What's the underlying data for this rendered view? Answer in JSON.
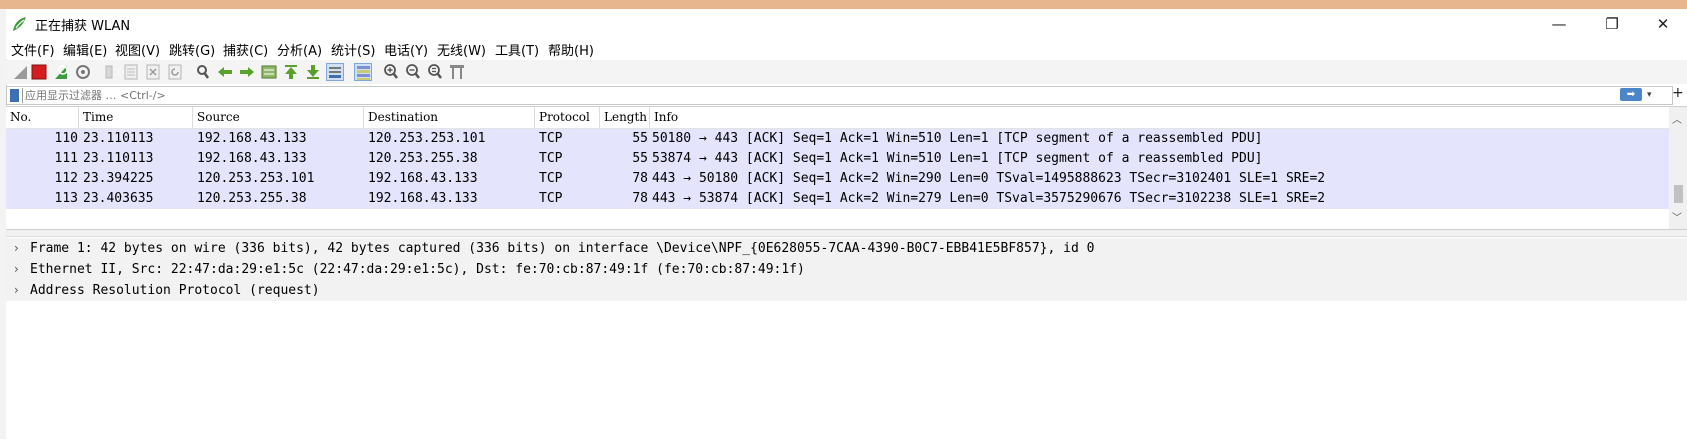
{
  "window": {
    "title": "正在捕获 WLAN",
    "minimize_glyph": "—",
    "maximize_glyph": "❐",
    "close_glyph": "✕"
  },
  "menu": [
    {
      "label": "文件(F)"
    },
    {
      "label": "编辑(E)"
    },
    {
      "label": "视图(V)"
    },
    {
      "label": "跳转(G)"
    },
    {
      "label": "捕获(C)"
    },
    {
      "label": "分析(A)"
    },
    {
      "label": "统计(S)"
    },
    {
      "label": "电话(Y)"
    },
    {
      "label": "无线(W)"
    },
    {
      "label": "工具(T)"
    },
    {
      "label": "帮助(H)"
    }
  ],
  "toolbar": {
    "icons": [
      "shark-fin-start-icon",
      "stop-capture-icon",
      "restart-capture-icon",
      "capture-options-icon",
      "open-file-icon",
      "save-file-icon",
      "close-file-icon",
      "reload-file-icon",
      "find-packet-icon",
      "go-back-icon",
      "go-forward-icon",
      "go-to-packet-icon",
      "first-packet-icon",
      "last-packet-icon",
      "autoscroll-icon",
      "colorize-icon",
      "zoom-in-icon",
      "zoom-out-icon",
      "normal-size-icon",
      "resize-columns-icon"
    ],
    "colors": {
      "stop": "#d21e1e",
      "shark": "#3d9a3d",
      "arrows": "#5aa02c",
      "neutral": "#8a8a8a"
    }
  },
  "filter": {
    "placeholder": "应用显示过滤器 … <Ctrl-/>",
    "apply_glyph": "➡",
    "dropdown_glyph": "▾",
    "add_glyph": "+"
  },
  "packet_list": {
    "columns": [
      "No.",
      "Time",
      "Source",
      "Destination",
      "Protocol",
      "Length",
      "Info"
    ],
    "rows": [
      {
        "no": "110",
        "time": "23.110113",
        "source": "192.168.43.133",
        "destination": "120.253.253.101",
        "protocol": "TCP",
        "length": "55",
        "info": "50180 → 443 [ACK] Seq=1 Ack=1 Win=510 Len=1 [TCP segment of a reassembled PDU]"
      },
      {
        "no": "111",
        "time": "23.110113",
        "source": "192.168.43.133",
        "destination": "120.253.255.38",
        "protocol": "TCP",
        "length": "55",
        "info": "53874 → 443 [ACK] Seq=1 Ack=1 Win=510 Len=1 [TCP segment of a reassembled PDU]"
      },
      {
        "no": "112",
        "time": "23.394225",
        "source": "120.253.253.101",
        "destination": "192.168.43.133",
        "protocol": "TCP",
        "length": "78",
        "info": "443 → 50180 [ACK] Seq=1 Ack=2 Win=290 Len=0 TSval=1495888623 TSecr=3102401 SLE=1 SRE=2"
      },
      {
        "no": "113",
        "time": "23.403635",
        "source": "120.253.255.38",
        "destination": "192.168.43.133",
        "protocol": "TCP",
        "length": "78",
        "info": "443 → 53874 [ACK] Seq=1 Ack=2 Win=279 Len=0 TSval=3575290676 TSecr=3102238 SLE=1 SRE=2"
      }
    ],
    "row_color": "#e4e4fd"
  },
  "details": {
    "rows": [
      {
        "text": "Frame 1: 42 bytes on wire (336 bits), 42 bytes captured (336 bits) on interface \\Device\\NPF_{0E628055-7CAA-4390-B0C7-EBB41E5BF857}, id 0"
      },
      {
        "text": "Ethernet II, Src: 22:47:da:29:e1:5c (22:47:da:29:e1:5c), Dst: fe:70:cb:87:49:1f (fe:70:cb:87:49:1f)"
      },
      {
        "text": "Address Resolution Protocol (request)"
      }
    ],
    "expand_glyph": "›",
    "selected_color": "#f2f2f2"
  }
}
